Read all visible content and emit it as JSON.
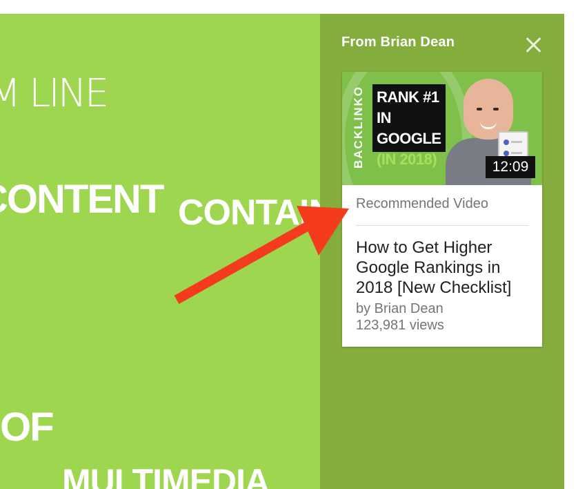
{
  "background_video": {
    "words": [
      "M LINE",
      "CONTENT",
      "CONTAIN",
      "OF",
      "MULTIMEDIA"
    ]
  },
  "endscreen_panel": {
    "title": "From Brian Dean",
    "close_icon": "close-icon",
    "card": {
      "thumbnail": {
        "brand": "BACKLINKO",
        "headline_lines": [
          "RANK #1",
          "IN GOOGLE",
          "(IN 2018)"
        ],
        "duration": "12:09"
      },
      "label": "Recommended Video",
      "title": "How to Get Higher Google Rankings in 2018 [New Checklist]",
      "author": "by Brian Dean",
      "views": "123,981 views"
    }
  },
  "colors": {
    "video_green": "#9fd64f",
    "panel_green": "#84ad3e",
    "arrow_red": "#f53b1e",
    "thumb_accent": "#a6e05a"
  }
}
